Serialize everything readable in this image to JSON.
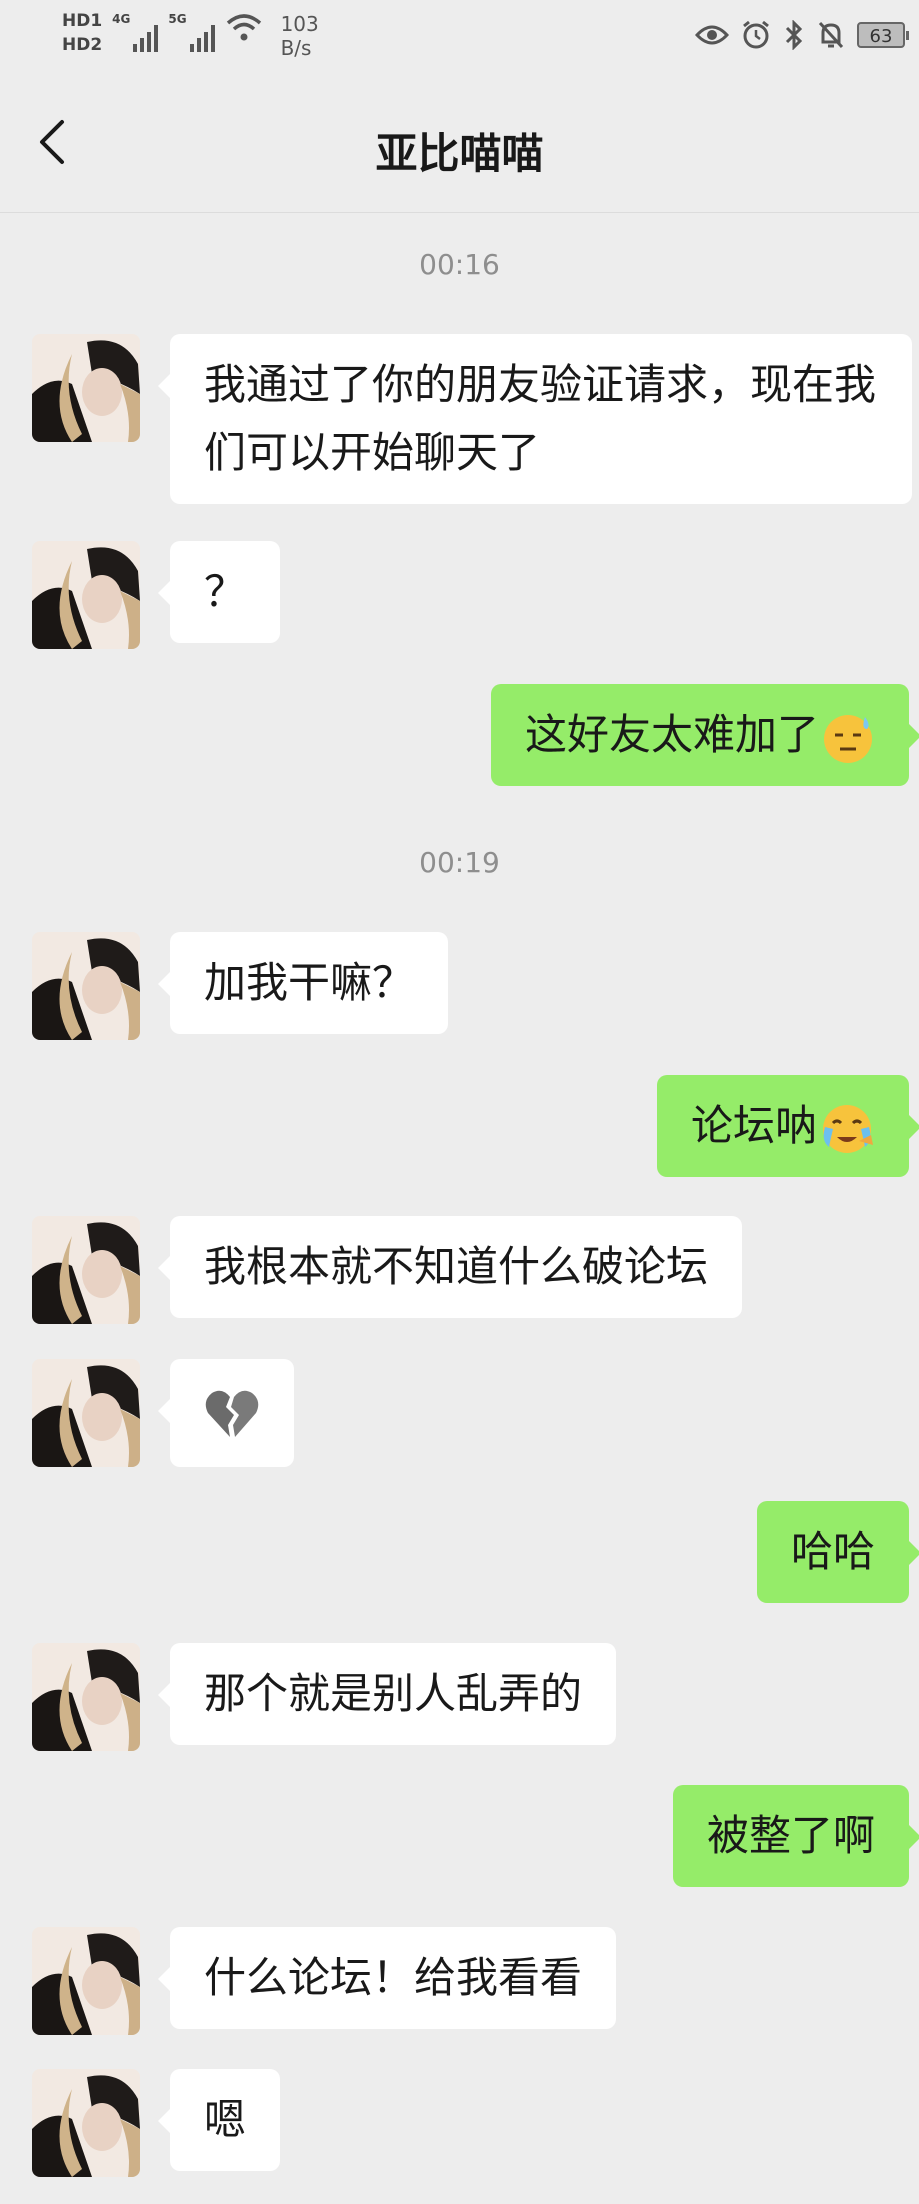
{
  "status_bar": {
    "hd1": "HD1",
    "hd2": "HD2",
    "signal1": "4G",
    "signal2": "5G",
    "speed_value": "103",
    "speed_unit": "B/s",
    "battery": "63"
  },
  "header": {
    "title": "亚比喵喵"
  },
  "messages": {
    "time1": "00:16",
    "m1": "我通过了你的朋友验证请求，现在我们可以开始聊天了",
    "m2": "？",
    "m3": "这好友太难加了",
    "time2": "00:19",
    "m4": "加我干嘛？",
    "m5": "论坛呐",
    "m6": "我根本就不知道什么破论坛",
    "m7_icon": "broken-heart-emoji",
    "m8": "哈哈",
    "m9": "那个就是别人乱弄的",
    "m10": "被整了啊",
    "m11": "什么论坛！给我看看",
    "m12": "嗯"
  },
  "colors": {
    "background": "#ededed",
    "self_bubble": "#95ec69",
    "other_bubble": "#ffffff"
  }
}
